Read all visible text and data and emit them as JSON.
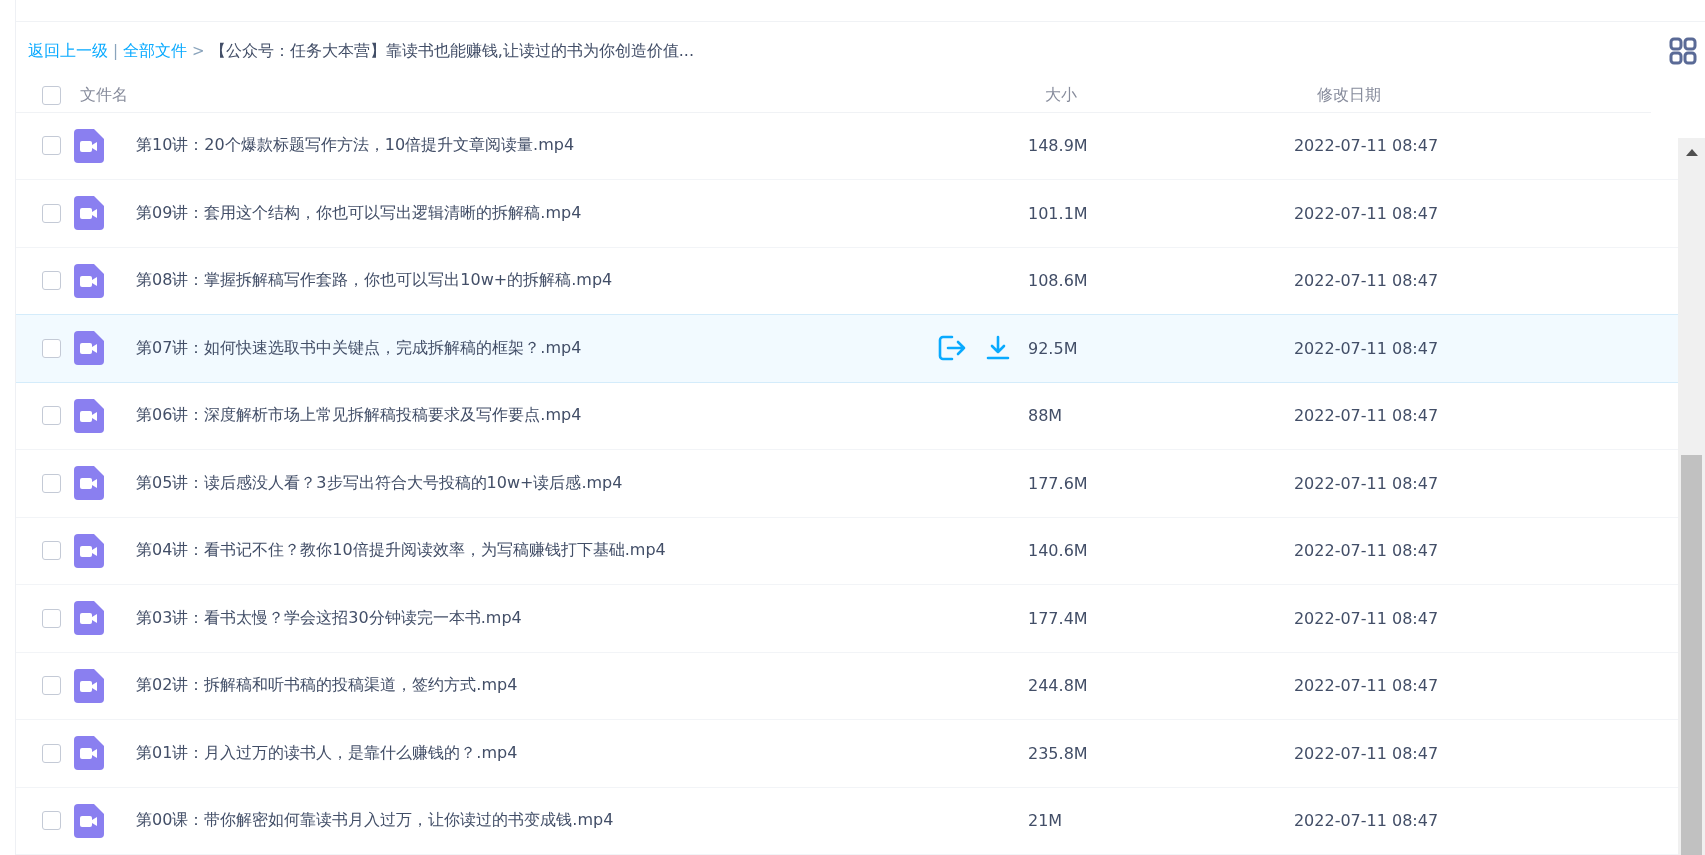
{
  "breadcrumb": {
    "back": "返回上一级",
    "separator": "|",
    "root": "全部文件",
    "arrow": ">",
    "current": "【公众号：任务大本营】靠读书也能赚钱,让读过的书为你创造价值..."
  },
  "table": {
    "select_all": {
      "checked": false
    },
    "columns": [
      "文件名",
      "大小",
      "修改日期"
    ],
    "rows": [
      {
        "name": "第10讲：20个爆款标题写作方法，10倍提升文章阅读量.mp4",
        "size": "148.9M",
        "date": "2022-07-11 08:47",
        "checked": false,
        "highlighted": false
      },
      {
        "name": "第09讲：套用这个结构，你也可以写出逻辑清晰的拆解稿.mp4",
        "size": "101.1M",
        "date": "2022-07-11 08:47",
        "checked": false,
        "highlighted": false
      },
      {
        "name": "第08讲：掌握拆解稿写作套路，你也可以写出10w+的拆解稿.mp4",
        "size": "108.6M",
        "date": "2022-07-11 08:47",
        "checked": false,
        "highlighted": false
      },
      {
        "name": "第07讲：如何快速选取书中关键点，完成拆解稿的框架？.mp4",
        "size": "92.5M",
        "date": "2022-07-11 08:47",
        "checked": false,
        "highlighted": true
      },
      {
        "name": "第06讲：深度解析市场上常见拆解稿投稿要求及写作要点.mp4",
        "size": "88M",
        "date": "2022-07-11 08:47",
        "checked": false,
        "highlighted": false
      },
      {
        "name": "第05讲：读后感没人看？3步写出符合大号投稿的10w+读后感.mp4",
        "size": "177.6M",
        "date": "2022-07-11 08:47",
        "checked": false,
        "highlighted": false
      },
      {
        "name": "第04讲：看书记不住？教你10倍提升阅读效率，为写稿赚钱打下基础.mp4",
        "size": "140.6M",
        "date": "2022-07-11 08:47",
        "checked": false,
        "highlighted": false
      },
      {
        "name": "第03讲：看书太慢？学会这招30分钟读完一本书.mp4",
        "size": "177.4M",
        "date": "2022-07-11 08:47",
        "checked": false,
        "highlighted": false
      },
      {
        "name": "第02讲：拆解稿和听书稿的投稿渠道，签约方式.mp4",
        "size": "244.8M",
        "date": "2022-07-11 08:47",
        "checked": false,
        "highlighted": false
      },
      {
        "name": "第01讲：月入过万的读书人，是靠什么赚钱的？.mp4",
        "size": "235.8M",
        "date": "2022-07-11 08:47",
        "checked": false,
        "highlighted": false
      },
      {
        "name": "第00课：带你解密如何靠读书月入过万，让你读过的书变成钱.mp4",
        "size": "21M",
        "date": "2022-07-11 08:47",
        "checked": false,
        "highlighted": false
      }
    ]
  }
}
